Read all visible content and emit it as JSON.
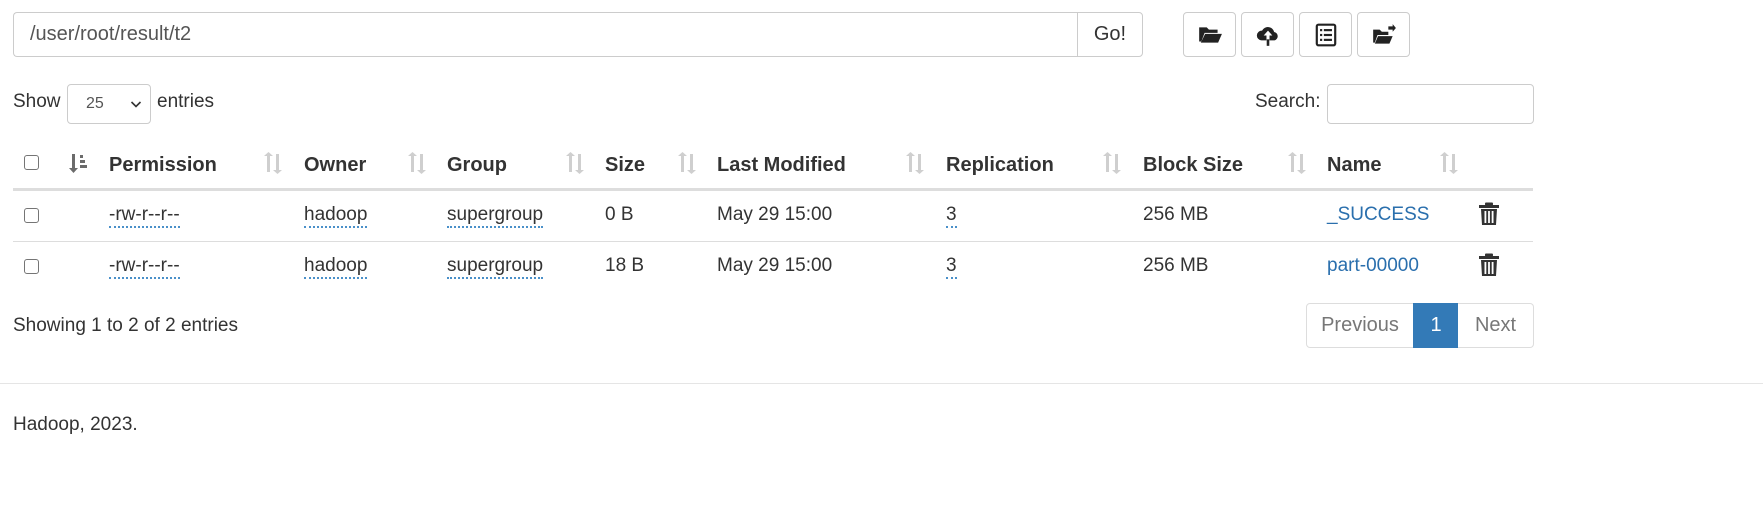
{
  "path_bar": {
    "path_value": "/user/root/result/t2",
    "go_label": "Go!"
  },
  "toolbar": {
    "buttons": [
      {
        "icon": "folder-open-icon"
      },
      {
        "icon": "cloud-upload-icon"
      },
      {
        "icon": "list-alt-icon"
      },
      {
        "icon": "folder-move-icon"
      }
    ]
  },
  "length": {
    "show_label": "Show",
    "selected": "25",
    "entries_label": "entries"
  },
  "search": {
    "label": "Search:",
    "value": ""
  },
  "table": {
    "columns": [
      "Permission",
      "Owner",
      "Group",
      "Size",
      "Last Modified",
      "Replication",
      "Block Size",
      "Name"
    ],
    "rows": [
      {
        "permission": "-rw-r--r--",
        "owner": "hadoop",
        "group": "supergroup",
        "size": "0 B",
        "modified": "May 29 15:00",
        "replication": "3",
        "block_size": "256 MB",
        "name": "_SUCCESS"
      },
      {
        "permission": "-rw-r--r--",
        "owner": "hadoop",
        "group": "supergroup",
        "size": "18 B",
        "modified": "May 29 15:00",
        "replication": "3",
        "block_size": "256 MB",
        "name": "part-00000"
      }
    ]
  },
  "info": "Showing 1 to 2 of 2 entries",
  "pagination": {
    "previous": "Previous",
    "current": "1",
    "next": "Next"
  },
  "footer": "Hadoop, 2023.",
  "colors": {
    "link": "#2a6fad",
    "active_page": "#337ab7",
    "border": "#cccccc"
  }
}
